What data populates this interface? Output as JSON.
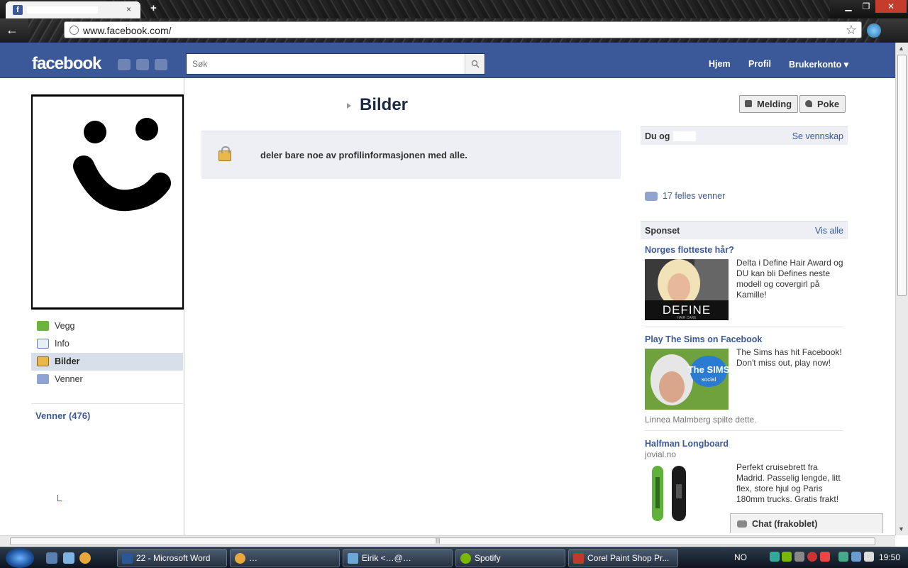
{
  "browser": {
    "tab_close": "×",
    "new_tab": "+",
    "url": "www.facebook.com/",
    "controls": {
      "minimize": "▁",
      "restore": "❐",
      "close": "✕"
    }
  },
  "fb": {
    "logo": "facebook",
    "search_placeholder": "Søk",
    "nav": {
      "home": "Hjem",
      "profile": "Profil",
      "account": "Brukerkonto ▾"
    }
  },
  "left": {
    "menu": [
      {
        "label": "Vegg",
        "icon": "wall-icon",
        "selected": false
      },
      {
        "label": "Info",
        "icon": "info-icon",
        "selected": false
      },
      {
        "label": "Bilder",
        "icon": "photos-icon",
        "selected": true
      },
      {
        "label": "Venner",
        "icon": "friends-icon",
        "selected": false
      }
    ],
    "friends_link": "Venner (476)"
  },
  "main": {
    "title": "Bilder",
    "privacy_message": "deler bare noe av profilinformasjonen med alle.",
    "actions": {
      "message": "Melding",
      "poke": "Poke"
    }
  },
  "right": {
    "you_and": {
      "title": "Du og",
      "link": "Se vennskap",
      "mutual": "17 felles venner"
    },
    "sponsored": {
      "title": "Sponset",
      "link": "Vis alle"
    },
    "ads": [
      {
        "title": "Norges flotteste hår?",
        "text": "Delta i Define Hair Award og DU kan bli Defines neste modell og covergirl på Kamille!",
        "image_text": "DEFINE",
        "image_sub": "HAIR CARE"
      },
      {
        "title": "Play The Sims on Facebook",
        "text": "The Sims has hit Facebook! Don't miss out, play now!",
        "image_text": "The SIMS",
        "image_sub": "social",
        "social": "Linnea Malmberg spilte dette."
      },
      {
        "title": "Halfman Longboard",
        "domain": "jovial.no",
        "text": "Perfekt cruisebrett fra Madrid. Passelig lengde, litt flex, store hjul og Paris 180mm trucks. Gratis frakt!"
      }
    ],
    "chat": "Chat (frakoblet)"
  },
  "taskbar": {
    "items": [
      {
        "label": "22 - Microsoft Word",
        "color": "#2b5797"
      },
      {
        "label": "…",
        "color": "#e8a73a"
      },
      {
        "label": "Eirik <…@…",
        "color": "#6fa6d8"
      },
      {
        "label": "Spotify",
        "color": "#7ab800"
      },
      {
        "label": "Corel Paint Shop Pr...",
        "color": "#c0392b"
      }
    ],
    "lang": "NO",
    "clock": "19:50"
  },
  "colors": {
    "fb_blue": "#3b5998",
    "link": "#3b5998",
    "light_panel": "#edeff4"
  }
}
